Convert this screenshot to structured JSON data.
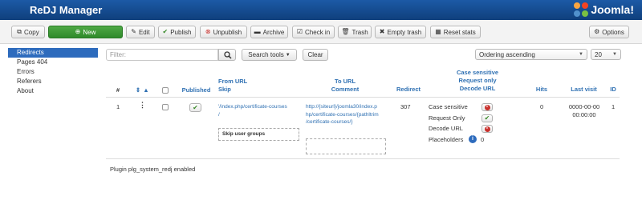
{
  "header": {
    "title": "ReDJ Manager",
    "brand": "Joomla!"
  },
  "toolbar": {
    "copy": "Copy",
    "new": "New",
    "edit": "Edit",
    "publish": "Publish",
    "unpublish": "Unpublish",
    "archive": "Archive",
    "checkin": "Check in",
    "trash": "Trash",
    "empty_trash": "Empty trash",
    "reset_stats": "Reset stats",
    "options": "Options"
  },
  "sidebar": {
    "items": [
      {
        "label": "Redirects",
        "active": true
      },
      {
        "label": "Pages 404",
        "active": false
      },
      {
        "label": "Errors",
        "active": false
      },
      {
        "label": "Referers",
        "active": false
      },
      {
        "label": "About",
        "active": false
      }
    ]
  },
  "filters": {
    "search_placeholder": "Filter:",
    "search_tools": "Search tools",
    "clear": "Clear",
    "ordering": "Ordering ascending",
    "limit": "20"
  },
  "table": {
    "headers": {
      "num": "#",
      "published": "Published",
      "from_url": "From URL",
      "skip": "Skip",
      "to_url": "To URL",
      "comment": "Comment",
      "redirect": "Redirect",
      "case_sensitive": "Case sensitive",
      "request_only": "Request only",
      "decode_url": "Decode URL",
      "hits": "Hits",
      "last_visit": "Last visit",
      "id": "ID"
    },
    "row": {
      "num": "1",
      "from_url_line1": "'/index.php/certificate-courses",
      "from_url_line2": "/",
      "skip_user_groups": "Skip user groups",
      "to_url_line1": "http://{siteurl}/joomla30/index.p",
      "to_url_line2": "hp/certificate-courses/{pathltrim",
      "to_url_line3": "/certificate-courses/}",
      "redirect": "307",
      "opt_case_label": "Case sensitive",
      "opt_request_label": "Request Only",
      "opt_decode_label": "Decode URL",
      "opt_placeholders_label": "Placeholders",
      "placeholders_count": "0",
      "hits": "0",
      "last_visit_line1": "0000-00-00",
      "last_visit_line2": "00:00:00",
      "id": "1"
    }
  },
  "footer": {
    "status": "Plugin plg_system_redj enabled"
  },
  "colors": {
    "header_blue": "#1c5aa6",
    "link_blue": "#3071b3",
    "new_green": "#3f9b38",
    "danger_red": "#c9302c"
  }
}
